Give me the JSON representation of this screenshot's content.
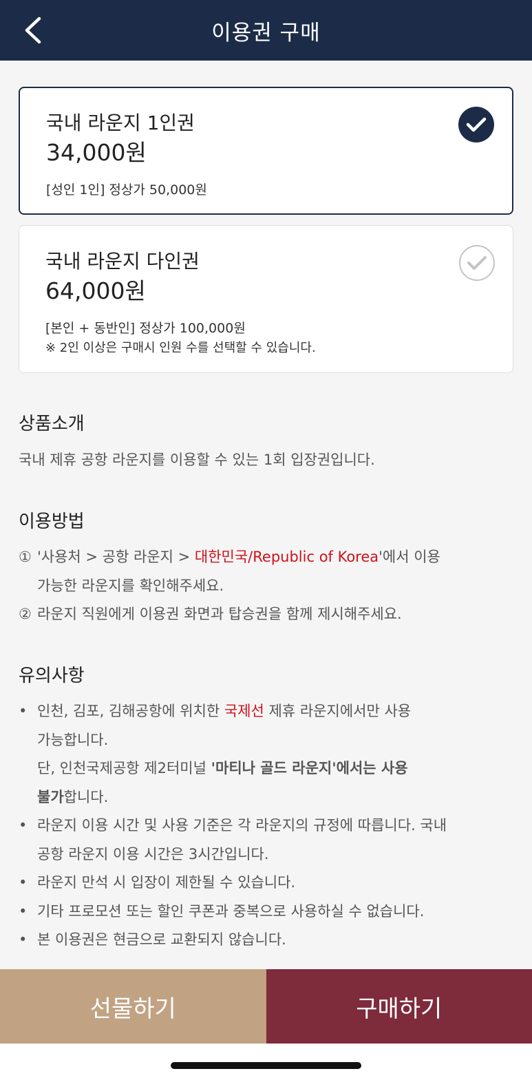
{
  "header": {
    "title": "이용권 구매"
  },
  "products": [
    {
      "name": "국내 라운지 1인권",
      "price": "34,000원",
      "desc1": "[성인 1인] 정상가 50,000원",
      "desc2": "",
      "selected": true
    },
    {
      "name": "국내 라운지 다인권",
      "price": "64,000원",
      "desc1": "[본인 + 동반인] 정상가 100,000원",
      "desc2": "※ 2인 이상은 구매시 인원 수를 선택할 수 있습니다.",
      "selected": false
    }
  ],
  "intro": {
    "title": "상품소개",
    "text": "국내 제휴 공항 라운지를 이용할 수 있는 1회 입장권입니다."
  },
  "usage": {
    "title": "이용방법",
    "step1_mark": "①",
    "step1_pre": "'사용처 > 공항 라운지 > ",
    "step1_highlight": "대한민국/Republic of Korea",
    "step1_post": "'에서 이용",
    "step1_cont": "가능한 라운지를 확인해주세요.",
    "step2_mark": "②",
    "step2": "라운지 직원에게 이용권 화면과 탑승권을 함께 제시해주세요."
  },
  "notice": {
    "title": "유의사항",
    "bullet": "•",
    "n1_pre": "인천, 김포, 김해공항에 위치한 ",
    "n1_highlight": "국제선",
    "n1_post": " 제휴 라운지에서만 사용",
    "n1_cont": "가능합니다.",
    "n1_sub_pre": "단, 인천국제공항 제2터미널 ",
    "n1_sub_bold": "'마티나 골드 라운지'에서는 사용",
    "n1_sub_bold2": "불가",
    "n1_sub_post": "합니다.",
    "n2": "라운지 이용 시간 및 사용 기준은 각 라운지의 규정에 따릅니다. 국내",
    "n2_cont": "공항 라운지 이용 시간은 3시간입니다.",
    "n3": "라운지 만석 시 입장이 제한될 수 있습니다.",
    "n4": "기타 프로모션 또는 할인 쿠폰과 중복으로 사용하실 수 없습니다.",
    "n5": "본 이용권은 현금으로 교환되지 않습니다."
  },
  "footer": {
    "gift_label": "선물하기",
    "buy_label": "구매하기"
  },
  "colors": {
    "navy": "#1c2c48",
    "gift": "#c1a282",
    "buy": "#7e2b3c",
    "highlight": "#d0101b"
  },
  "icons": {
    "back": "chevron-left-icon",
    "check": "check-icon"
  }
}
